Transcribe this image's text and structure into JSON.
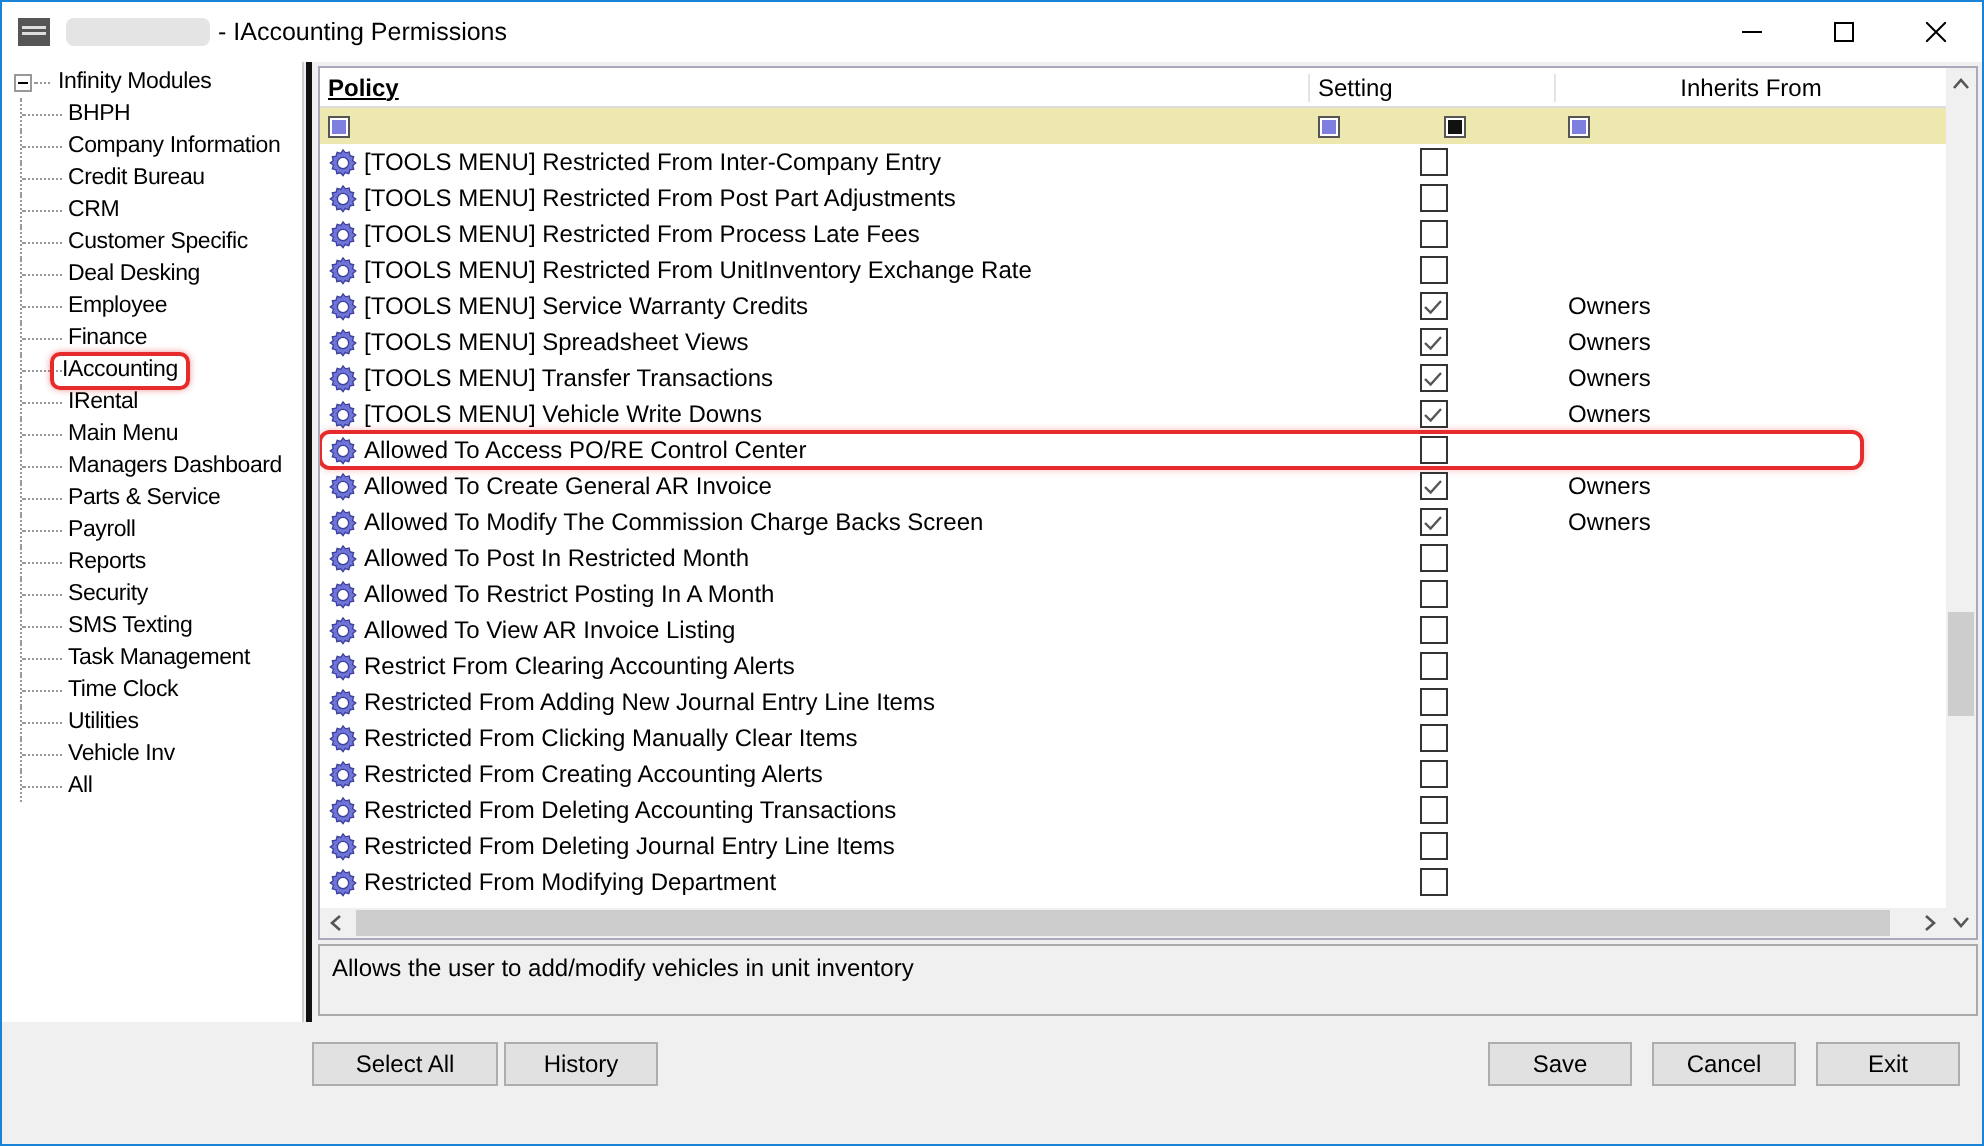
{
  "window": {
    "title": "- IAccounting Permissions"
  },
  "tree": {
    "root": "Infinity Modules",
    "expanded": true,
    "children": [
      {
        "label": "BHPH",
        "highlighted": false
      },
      {
        "label": "Company Information",
        "highlighted": false
      },
      {
        "label": "Credit Bureau",
        "highlighted": false
      },
      {
        "label": "CRM",
        "highlighted": false
      },
      {
        "label": "Customer Specific",
        "highlighted": false
      },
      {
        "label": "Deal Desking",
        "highlighted": false
      },
      {
        "label": "Employee",
        "highlighted": false
      },
      {
        "label": "Finance",
        "highlighted": false
      },
      {
        "label": "IAccounting",
        "highlighted": true
      },
      {
        "label": "IRental",
        "highlighted": false
      },
      {
        "label": "Main Menu",
        "highlighted": false
      },
      {
        "label": "Managers Dashboard",
        "highlighted": false
      },
      {
        "label": "Parts & Service",
        "highlighted": false
      },
      {
        "label": "Payroll",
        "highlighted": false
      },
      {
        "label": "Reports",
        "highlighted": false
      },
      {
        "label": "Security",
        "highlighted": false
      },
      {
        "label": "SMS Texting",
        "highlighted": false
      },
      {
        "label": "Task Management",
        "highlighted": false
      },
      {
        "label": "Time Clock",
        "highlighted": false
      },
      {
        "label": "Utilities",
        "highlighted": false
      },
      {
        "label": "Vehicle Inv",
        "highlighted": false
      },
      {
        "label": "All",
        "highlighted": false
      }
    ]
  },
  "table": {
    "columns": [
      "Policy",
      "Setting",
      "Inherits From"
    ],
    "rows": [
      {
        "policy": "[TOOLS MENU] Restricted From Inter-Company Entry",
        "checked": false,
        "inherits": "",
        "highlighted": false
      },
      {
        "policy": "[TOOLS MENU] Restricted From Post Part Adjustments",
        "checked": false,
        "inherits": "",
        "highlighted": false
      },
      {
        "policy": "[TOOLS MENU] Restricted From Process Late Fees",
        "checked": false,
        "inherits": "",
        "highlighted": false
      },
      {
        "policy": "[TOOLS MENU] Restricted From UnitInventory Exchange Rate",
        "checked": false,
        "inherits": "",
        "highlighted": false
      },
      {
        "policy": "[TOOLS MENU] Service Warranty Credits",
        "checked": true,
        "inherits": "Owners",
        "highlighted": false
      },
      {
        "policy": "[TOOLS MENU] Spreadsheet Views",
        "checked": true,
        "inherits": "Owners",
        "highlighted": false
      },
      {
        "policy": "[TOOLS MENU] Transfer Transactions",
        "checked": true,
        "inherits": "Owners",
        "highlighted": false
      },
      {
        "policy": "[TOOLS MENU] Vehicle Write Downs",
        "checked": true,
        "inherits": "Owners",
        "highlighted": false
      },
      {
        "policy": "Allowed To Access PO/RE Control Center",
        "checked": false,
        "inherits": "",
        "highlighted": true
      },
      {
        "policy": "Allowed To Create General AR Invoice",
        "checked": true,
        "inherits": "Owners",
        "highlighted": false
      },
      {
        "policy": "Allowed To Modify The Commission Charge Backs Screen",
        "checked": true,
        "inherits": "Owners",
        "highlighted": false
      },
      {
        "policy": "Allowed To Post In Restricted Month",
        "checked": false,
        "inherits": "",
        "highlighted": false
      },
      {
        "policy": "Allowed To Restrict Posting In A Month",
        "checked": false,
        "inherits": "",
        "highlighted": false
      },
      {
        "policy": "Allowed To View AR Invoice Listing",
        "checked": false,
        "inherits": "",
        "highlighted": false
      },
      {
        "policy": "Restrict From Clearing Accounting Alerts",
        "checked": false,
        "inherits": "",
        "highlighted": false
      },
      {
        "policy": "Restricted From Adding New Journal Entry Line Items",
        "checked": false,
        "inherits": "",
        "highlighted": false
      },
      {
        "policy": "Restricted From Clicking Manually Clear Items",
        "checked": false,
        "inherits": "",
        "highlighted": false
      },
      {
        "policy": "Restricted From Creating Accounting Alerts",
        "checked": false,
        "inherits": "",
        "highlighted": false
      },
      {
        "policy": "Restricted From Deleting Accounting Transactions",
        "checked": false,
        "inherits": "",
        "highlighted": false
      },
      {
        "policy": "Restricted From Deleting Journal Entry Line Items",
        "checked": false,
        "inherits": "",
        "highlighted": false
      },
      {
        "policy": "Restricted From Modifying Department",
        "checked": false,
        "inherits": "",
        "highlighted": false
      }
    ]
  },
  "description": "Allows the user to add/modify vehicles in unit inventory",
  "left_buttons": [
    "Select All",
    "History"
  ],
  "right_buttons": [
    "Save",
    "Cancel",
    "Exit"
  ]
}
